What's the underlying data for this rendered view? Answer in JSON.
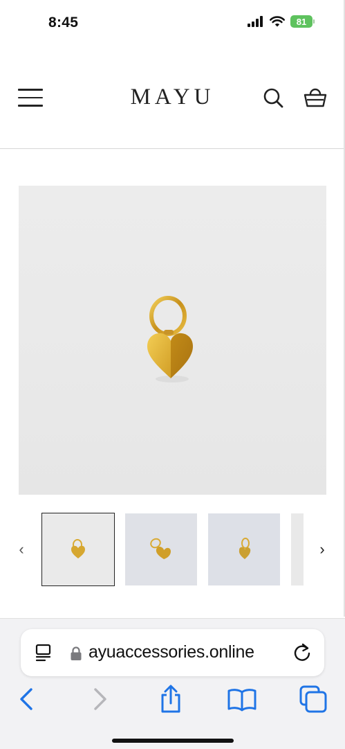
{
  "status_bar": {
    "time": "8:45",
    "battery_level": "81",
    "icons": [
      "signal-icon",
      "wifi-icon",
      "battery-charging-icon"
    ]
  },
  "header": {
    "logo": "MAYU",
    "icons": [
      "menu-icon",
      "search-icon",
      "cart-basket-icon"
    ]
  },
  "product": {
    "main_image": "gold-heart-charm-on-ring",
    "thumbnails": [
      {
        "name": "thumb-front",
        "active": true
      },
      {
        "name": "thumb-side",
        "active": false
      },
      {
        "name": "thumb-angle",
        "active": false
      },
      {
        "name": "thumb-partial",
        "active": false
      }
    ],
    "prev_label": "‹",
    "next_label": "›"
  },
  "browser": {
    "url": "ayuaccessories.online",
    "icons": [
      "reader-mode-icon",
      "lock-icon",
      "reload-icon"
    ],
    "toolbar": [
      "back-icon",
      "forward-icon",
      "share-icon",
      "bookmarks-icon",
      "tabs-icon"
    ]
  },
  "colors": {
    "accent_blue": "#1f74e6",
    "gold": "#d6a730",
    "battery_green": "#5ec25e"
  }
}
